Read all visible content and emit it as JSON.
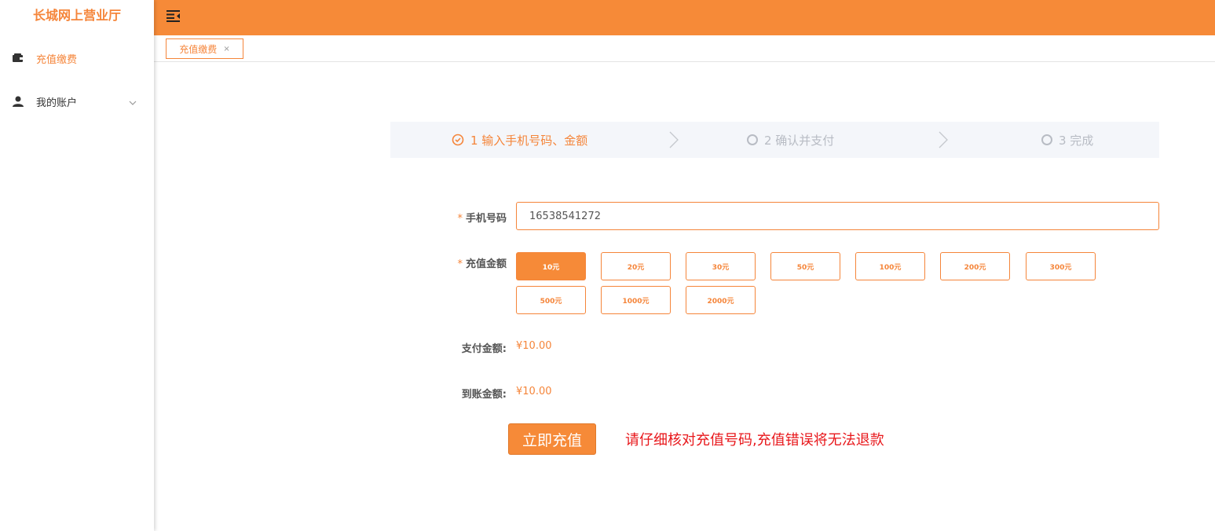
{
  "app": {
    "title": "长城网上营业厅"
  },
  "sidebar": {
    "items": [
      {
        "label": "充值缴费",
        "icon": "wallet-icon",
        "active": true
      },
      {
        "label": "我的账户",
        "icon": "user-icon",
        "active": false,
        "expandable": true
      }
    ]
  },
  "topbar": {
    "menu_icon": "menu-fold-icon"
  },
  "tabs": [
    {
      "label": "充值缴费",
      "close": "×"
    }
  ],
  "steps": [
    {
      "label": "1 输入手机号码、金额",
      "status": "active"
    },
    {
      "label": "2 确认并支付",
      "status": "pending"
    },
    {
      "label": "3 完成",
      "status": "pending"
    }
  ],
  "form": {
    "phone": {
      "label": "手机号码",
      "required_mark": "*",
      "value": "16538541272"
    },
    "amount": {
      "label": "充值金额",
      "required_mark": "*",
      "options": [
        "10元",
        "20元",
        "30元",
        "50元",
        "100元",
        "200元",
        "300元",
        "500元",
        "1000元",
        "2000元"
      ],
      "selected": "10元"
    },
    "pay_amount": {
      "label": "支付金额:",
      "value": "¥10.00"
    },
    "arrive_amount": {
      "label": "到账金额:",
      "value": "¥10.00"
    },
    "submit_label": "立即充值",
    "warning": "请仔细核对充值号码,充值错误将无法退款"
  },
  "colors": {
    "accent": "#F68A38",
    "warning": "#E8171B",
    "step_bg": "#F4F6FA"
  }
}
